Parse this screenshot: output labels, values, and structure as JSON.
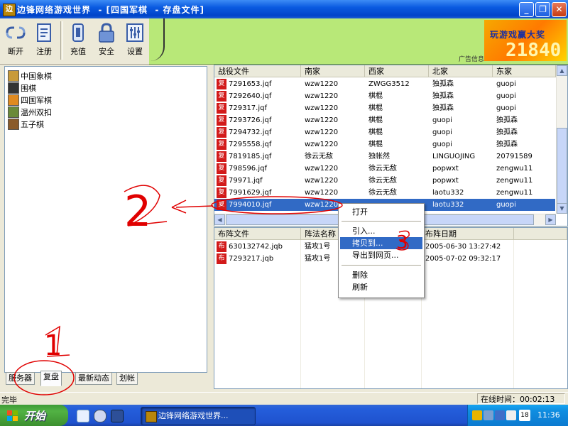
{
  "window": {
    "title": "边锋网络游戏世界  - [四国军棋  - 存盘文件]",
    "icon": "app-logo-icon",
    "controls": [
      "minimize",
      "restore",
      "close"
    ]
  },
  "toolbar": {
    "buttons": [
      {
        "label": "断开",
        "icon": "disconnect-icon"
      },
      {
        "label": "注册",
        "icon": "register-icon"
      },
      {
        "label": "充值",
        "icon": "recharge-icon"
      },
      {
        "label": "安全",
        "icon": "lock-icon"
      },
      {
        "label": "设置",
        "icon": "settings-icon"
      }
    ]
  },
  "banner": {
    "ad_label": "广告信息",
    "ad_slogan": "玩游戏赢大奖",
    "ad_number": "21840"
  },
  "games": [
    {
      "label": "中国象棋",
      "icon": "chess-icon"
    },
    {
      "label": "围棋",
      "icon": "go-icon"
    },
    {
      "label": "四国军棋",
      "icon": "army-chess-icon"
    },
    {
      "label": "温州双扣",
      "icon": "cards-icon"
    },
    {
      "label": "五子棋",
      "icon": "gomoku-icon"
    }
  ],
  "left_tabs": [
    "服务器",
    "复盘",
    "最新动态",
    "划帐"
  ],
  "left_tabs_active": "复盘",
  "battle_files": {
    "columns": [
      "战役文件",
      "南家",
      "西家",
      "北家",
      "东家"
    ],
    "rows": [
      [
        "7291653.jqf",
        "wzw1220",
        "ZWGG3512",
        "独孤森",
        "guopi"
      ],
      [
        "7292640.jqf",
        "wzw1220",
        "棋棍",
        "独孤森",
        "guopi"
      ],
      [
        "729317.jqf",
        "wzw1220",
        "棋棍",
        "独孤森",
        "guopi"
      ],
      [
        "7293726.jqf",
        "wzw1220",
        "棋棍",
        "guopi",
        "独孤森"
      ],
      [
        "7294732.jqf",
        "wzw1220",
        "棋棍",
        "guopi",
        "独孤森"
      ],
      [
        "7295558.jqf",
        "wzw1220",
        "棋棍",
        "guopi",
        "独孤森"
      ],
      [
        "7819185.jqf",
        "徐云无敌",
        "独帐然",
        "LINGUOJING",
        "20791589"
      ],
      [
        "798596.jqf",
        "wzw1220",
        "徐云无敌",
        "popwxt",
        "zengwu11"
      ],
      [
        "79971.jqf",
        "wzw1220",
        "徐云无敌",
        "popwxt",
        "zengwu11"
      ],
      [
        "7991629.jqf",
        "wzw1220",
        "徐云无敌",
        "laotu332",
        "zengwu11"
      ],
      [
        "7994010.jqf",
        "wzw1220",
        "",
        "laotu332",
        "guopi"
      ]
    ],
    "selected_index": 10,
    "icon_char": "复"
  },
  "layout_files": {
    "columns": [
      "布阵文件",
      "阵法名称",
      "",
      "布阵日期"
    ],
    "rows": [
      [
        "630132742.jqb",
        "猛攻1号",
        "2005-06-30 13:27:42"
      ],
      [
        "7293217.jqb",
        "猛攻1号",
        "2005-07-02 09:32:17"
      ]
    ],
    "icon_char": "布"
  },
  "context_menu": {
    "items": [
      "打开",
      "引入...",
      "拷贝到...",
      "导出到网页...",
      "删除",
      "刷新"
    ],
    "highlighted": "拷贝到..."
  },
  "status": {
    "left": "完毕",
    "online_time": "在线时间：00:02:13"
  },
  "taskbar": {
    "start_label": "开始",
    "task_item": "边锋网络游戏世界...",
    "clock": "11:36",
    "tray_date": "18"
  },
  "annotations": {
    "labels": [
      "1",
      "2",
      "3"
    ],
    "color": "#e00000"
  },
  "colors": {
    "selection": "#316ac5",
    "titlebar": "#0a5ae0",
    "banner": "#b8e878"
  }
}
